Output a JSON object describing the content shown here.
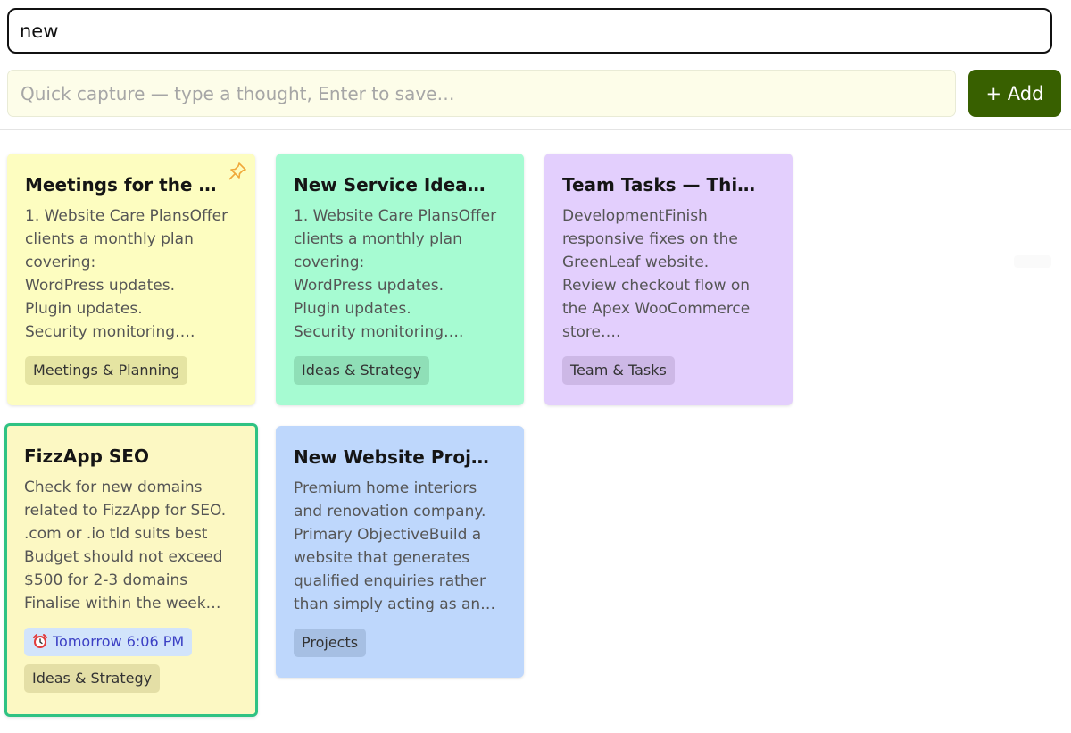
{
  "search": {
    "value": "new"
  },
  "capture": {
    "placeholder": "Quick capture — type a thought, Enter to save…",
    "add_label": "+ Add"
  },
  "notes": [
    {
      "title": "Meetings for the …",
      "body": "1. Website Care PlansOffer\nclients a monthly plan\ncovering:\nWordPress updates.\nPlugin updates.\nSecurity monitoring….",
      "tag": "Meetings & Planning",
      "color": "#fdfdc0",
      "tag_color": "#e5e4a2",
      "pinned": true,
      "pin_icon": "pin-icon"
    },
    {
      "title": "New Service Idea…",
      "body": "1. Website Care PlansOffer\nclients a monthly plan\ncovering:\nWordPress updates.\nPlugin updates.\nSecurity monitoring….",
      "tag": "Ideas & Strategy",
      "color": "#a6fbd2",
      "tag_color": "#8fdfb7"
    },
    {
      "title": "Team Tasks — Thi…",
      "body": "DevelopmentFinish\nresponsive fixes on the\nGreenLeaf website.\nReview checkout flow on\nthe Apex WooCommerce\nstore….",
      "tag": "Team & Tasks",
      "color": "#e3cffd",
      "tag_color": "#cdb8e6"
    },
    {
      "title": "FizzApp SEO",
      "body": "Check for new domains\nrelated to FizzApp for SEO.\n.com or .io tld suits best\nBudget should not exceed\n$500 for 2-3 domains\nFinalise within the week…",
      "reminder": "Tomorrow 6:06 PM",
      "reminder_icon": "alarm-clock-icon",
      "tag": "Ideas & Strategy",
      "color": "#fcf8c3",
      "tag_color": "#e4dfa6",
      "selected": true
    },
    {
      "title": "New Website Proj…",
      "body": "Premium home interiors\nand renovation company.\nPrimary ObjectiveBuild a\nwebsite that generates\nqualified enquiries rather\nthan simply acting as an…",
      "tag": "Projects",
      "color": "#bed7fc",
      "tag_color": "#a6bfe3"
    }
  ],
  "colors": {
    "accent": "#386000",
    "selected_border": "#2fc283"
  }
}
